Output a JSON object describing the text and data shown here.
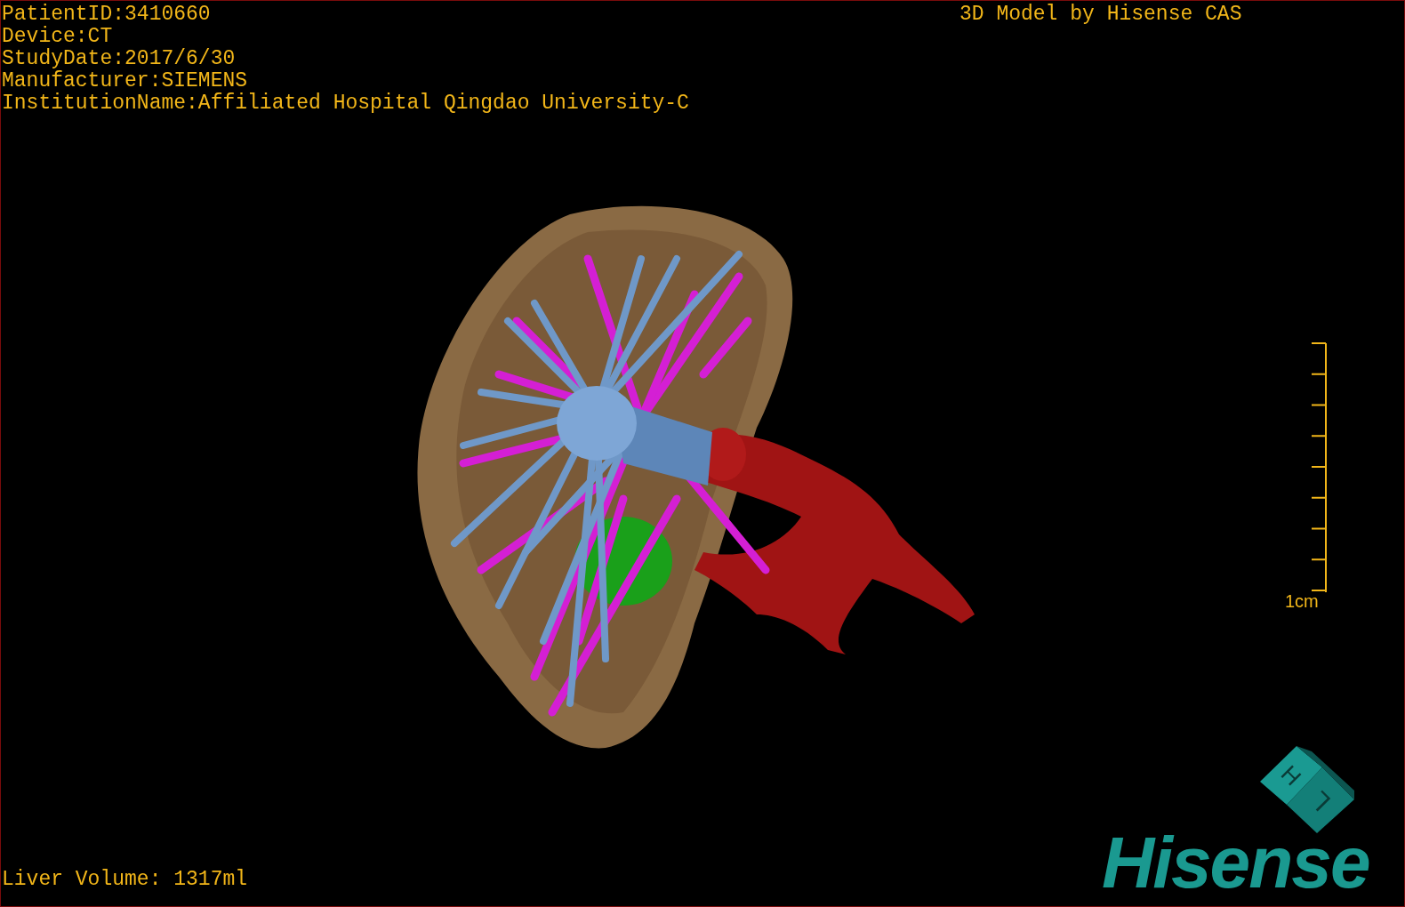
{
  "study_info": [
    "PatientID:3410660",
    "Device:CT",
    "StudyDate:2017/6/30",
    "Manufacturer:SIEMENS",
    "InstitutionName:Affiliated Hospital Qingdao University-C"
  ],
  "title": "3D Model by Hisense CAS",
  "scale_bar": {
    "label": "1cm"
  },
  "liver_volume": "Liver Volume: 1317ml",
  "orientation_cube": {
    "face_labels": [
      "H",
      "L"
    ]
  },
  "logo": "Hisense"
}
